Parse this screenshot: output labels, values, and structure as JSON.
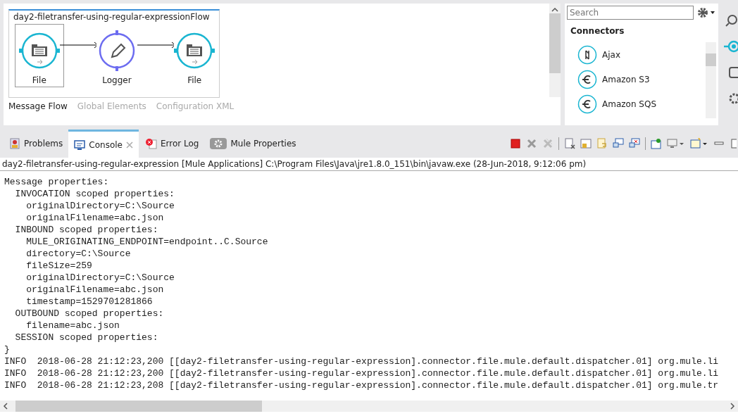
{
  "flow": {
    "title": "day2-filetransfer-using-regular-expressionFlow",
    "nodes": [
      {
        "label": "File",
        "kind": "file",
        "selected": true
      },
      {
        "label": "Logger",
        "kind": "logger",
        "selected": false
      },
      {
        "label": "File",
        "kind": "file",
        "selected": false
      }
    ]
  },
  "editor_tabs": [
    {
      "label": "Message Flow",
      "selected": true
    },
    {
      "label": "Global Elements",
      "selected": false
    },
    {
      "label": "Configuration XML",
      "selected": false
    }
  ],
  "palette": {
    "search": {
      "placeholder": "Search"
    },
    "heading": "Connectors",
    "items": [
      {
        "label": "Ajax",
        "kind": "ajax"
      },
      {
        "label": "Amazon S3",
        "kind": "connector"
      },
      {
        "label": "Amazon SQS",
        "kind": "connector"
      }
    ]
  },
  "console_tabs": [
    {
      "label": "Problems",
      "kind": "problems",
      "selected": false
    },
    {
      "label": "Console",
      "kind": "console",
      "selected": true
    },
    {
      "label": "Error Log",
      "kind": "errorlog",
      "selected": false
    },
    {
      "label": "Mule Properties",
      "kind": "properties",
      "selected": false
    }
  ],
  "console": {
    "header": "day2-filetransfer-using-regular-expression [Mule Applications] C:\\Program Files\\Java\\jre1.8.0_151\\bin\\javaw.exe (28-Jun-2018, 9:12:06 pm)",
    "lines": [
      "Message properties:",
      "  INVOCATION scoped properties:",
      "    originalDirectory=C:\\Source",
      "    originalFilename=abc.json",
      "  INBOUND scoped properties:",
      "    MULE_ORIGINATING_ENDPOINT=endpoint..C.Source",
      "    directory=C:\\Source",
      "    fileSize=259",
      "    originalDirectory=C:\\Source",
      "    originalFilename=abc.json",
      "    timestamp=1529701281866",
      "  OUTBOUND scoped properties:",
      "    filename=abc.json",
      "  SESSION scoped properties:",
      "}",
      "INFO  2018-06-28 21:12:23,200 [[day2-filetransfer-using-regular-expression].connector.file.mule.default.dispatcher.01] org.mule.li",
      "INFO  2018-06-28 21:12:23,200 [[day2-filetransfer-using-regular-expression].connector.file.mule.default.dispatcher.01] org.mule.li",
      "INFO  2018-06-28 21:12:23,208 [[day2-filetransfer-using-regular-expression].connector.file.mule.default.dispatcher.01] org.mule.tr"
    ]
  }
}
